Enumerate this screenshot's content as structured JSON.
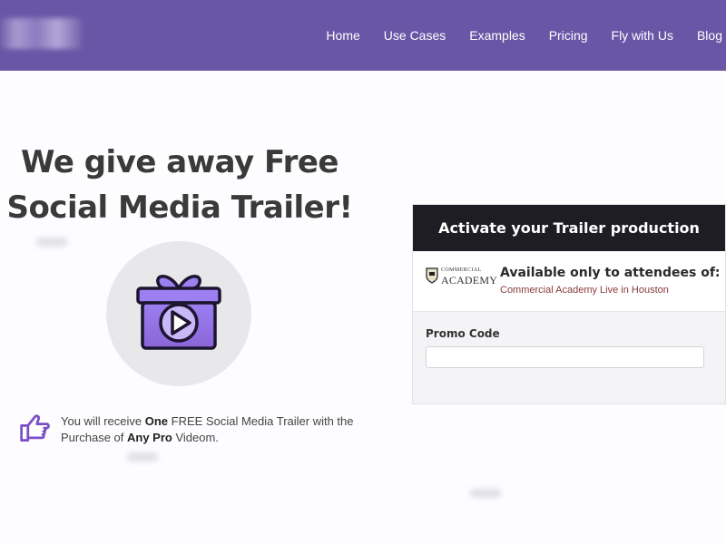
{
  "nav": {
    "items": [
      {
        "label": "Home"
      },
      {
        "label": "Use Cases"
      },
      {
        "label": "Examples"
      },
      {
        "label": "Pricing"
      },
      {
        "label": "Fly with Us"
      },
      {
        "label": "Blog"
      }
    ]
  },
  "hero": {
    "title_line1": "We give away Free",
    "title_line2": "Social Media Trailer!"
  },
  "offer": {
    "part1": "You will receive ",
    "bold1": "One",
    "part2": " FREE Social Media Trailer with the Purchase of ",
    "bold2": "Any Pro",
    "part3": " Videom."
  },
  "card": {
    "header": "Activate your Trailer production",
    "logo_top": "COMMERCIAL",
    "logo_bottom": "ACADEMY",
    "available_title": "Available only to attendees of:",
    "event_name": "Commercial Academy Live in Houston",
    "promo_label": "Promo Code",
    "promo_value": "",
    "promo_placeholder": ""
  },
  "icons": {
    "gift": "gift-play-icon",
    "hand": "pointing-hand-icon",
    "shield": "academy-shield-icon"
  },
  "colors": {
    "nav_bg": "#6a56a6",
    "accent_purple": "#8f6ee0",
    "card_header_bg": "#1f1d24"
  }
}
